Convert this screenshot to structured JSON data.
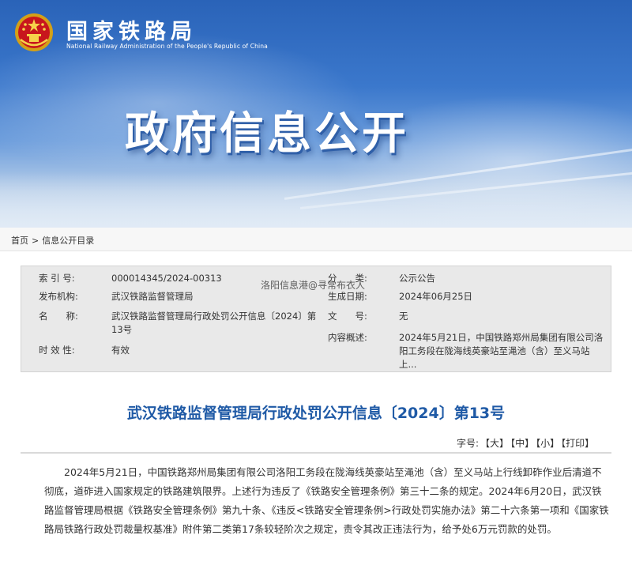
{
  "header": {
    "brand_cn": "国家铁路局",
    "brand_en": "National Railway Administration of the People's Republic of China",
    "banner_title": "政府信息公开"
  },
  "breadcrumb": {
    "home": "首页",
    "separator": ">",
    "current": "信息公开目录"
  },
  "info_table": {
    "index_label": "索 引 号:",
    "index_value": "000014345/2024-00313",
    "category_label": "分　　类:",
    "category_value": "公示公告",
    "publisher_label": "发布机构:",
    "publisher_value": "武汉铁路监督管理局",
    "date_label": "生成日期:",
    "date_value": "2024年06月25日",
    "name_label": "名　　称:",
    "name_value": "武汉铁路监督管理局行政处罚公开信息〔2024〕第13号",
    "docno_label": "文　　号:",
    "docno_value": "无",
    "summary_label": "内容概述:",
    "summary_value": "2024年5月21日，中国铁路郑州局集团有限公司洛阳工务段在陇海线英豪站至渑池（含）至义马站上...",
    "validity_label": "时 效 性:",
    "validity_value": "有效"
  },
  "watermark": "洛阳信息港@寻常布衣人",
  "document": {
    "title": "武汉铁路监督管理局行政处罚公开信息〔2024〕第13号",
    "font_label": "字号:",
    "font_large": "【大】",
    "font_medium": "【中】",
    "font_small": "【小】",
    "print": "【打印】",
    "paragraph": "2024年5月21日，中国铁路郑州局集团有限公司洛阳工务段在陇海线英豪站至渑池（含）至义马站上行线卸砟作业后清道不彻底，道砟进入国家规定的铁路建筑限界。上述行为违反了《铁路安全管理条例》第三十二条的规定。2024年6月20日，武汉铁路监督管理局根据《铁路安全管理条例》第九十条、《违反<铁路安全管理条例>行政处罚实施办法》第二十六条第一项和《国家铁路局铁路行政处罚裁量权基准》附件第二类第17条较轻阶次之规定，责令其改正违法行为，给予处6万元罚款的处罚。"
  }
}
